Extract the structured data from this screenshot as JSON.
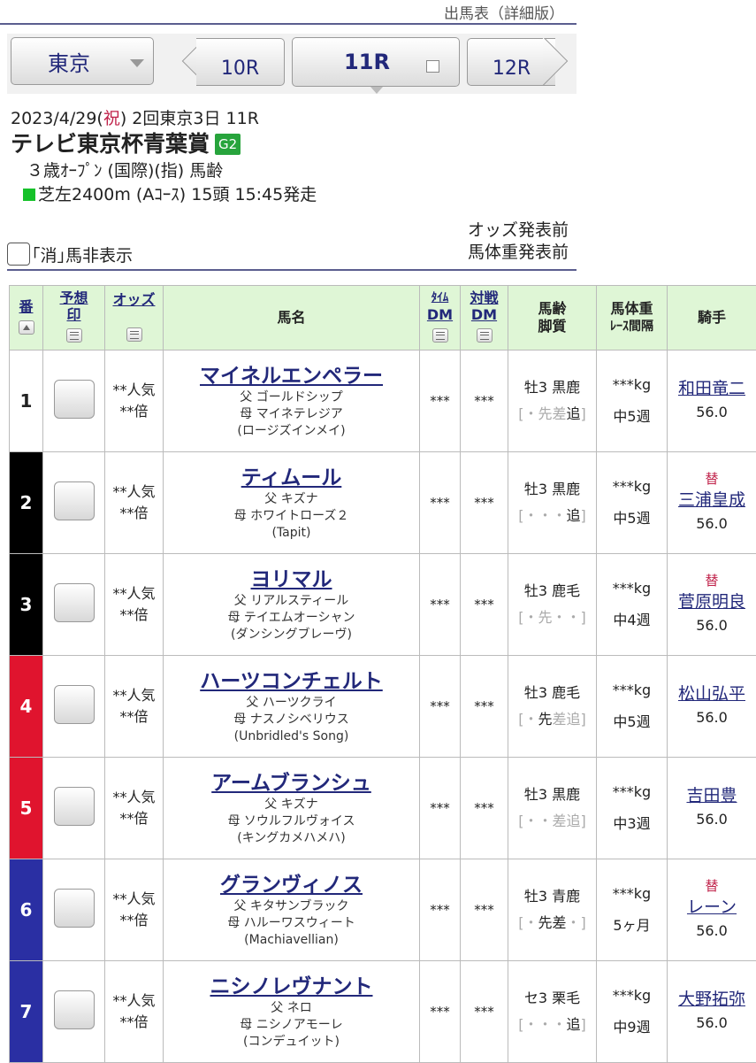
{
  "page_label": "出馬表（詳細版）",
  "nav": {
    "venue": "東京",
    "prev_race": "10R",
    "current_race": "11R",
    "next_race": "12R"
  },
  "race": {
    "date": "2023/4/29(",
    "holiday": "祝",
    "date_rest": ") 2回東京3日 11R",
    "name": "テレビ東京杯青葉賞",
    "grade": "G2",
    "conditions": "３歳ｵｰﾌﾟﾝ (国際)(指) 馬齢",
    "course": "芝左2400m (Aｺｰｽ) 15頭 15:45発走"
  },
  "hide_scratched_label": "｢消｣馬非表示",
  "status": {
    "odds": "オッズ発表前",
    "weight": "馬体重発表前"
  },
  "colors": {
    "frame_1": "#ffffff",
    "frame_2": "#000000",
    "frame_3": "#e0142e",
    "frame_4": "#2a2fa3",
    "header_bg": "#dff6d6",
    "link": "#22287a",
    "grade_badge": "#27a43c",
    "change_mark": "#c0224a"
  },
  "table": {
    "headers": {
      "num": "番",
      "mark": [
        "予想",
        "印"
      ],
      "odds": "オッズ",
      "name": "馬名",
      "time_dm": [
        "ﾀｲﾑ",
        "DM"
      ],
      "vs_dm": [
        "対戦",
        "DM"
      ],
      "age": [
        "馬齢",
        "脚質"
      ],
      "weight": [
        "馬体重",
        "ﾚｰｽ間隔"
      ],
      "jockey": "騎手"
    },
    "rows": [
      {
        "num": "1",
        "frame": 1,
        "odds1": "**人気",
        "odds2": "**倍",
        "name": "マイネルエンペラー",
        "sire": "父 ゴールドシップ",
        "dam": "母 マイネテレジア",
        "bms": "(ロージズインメイ)",
        "tdm": "***",
        "vdm": "***",
        "age": "牡3 黒鹿",
        "legs": [
          {
            "t": "[",
            "on": false
          },
          {
            "t": "・",
            "on": false
          },
          {
            "t": "先",
            "on": false
          },
          {
            "t": "差",
            "on": false
          },
          {
            "t": "追",
            "on": true
          },
          {
            "t": "]",
            "on": false
          }
        ],
        "weight": "***kg",
        "interval": "中5週",
        "change": "",
        "jockey": "和田竜二",
        "jwt": "56.0"
      },
      {
        "num": "2",
        "frame": 2,
        "odds1": "**人気",
        "odds2": "**倍",
        "name": "ティムール",
        "sire": "父 キズナ",
        "dam": "母 ホワイトローズ２",
        "bms": "(Tapit)",
        "tdm": "***",
        "vdm": "***",
        "age": "牡3 黒鹿",
        "legs": [
          {
            "t": "[",
            "on": false
          },
          {
            "t": "・",
            "on": false
          },
          {
            "t": "・",
            "on": false
          },
          {
            "t": "・",
            "on": false
          },
          {
            "t": "追",
            "on": true
          },
          {
            "t": "]",
            "on": false
          }
        ],
        "weight": "***kg",
        "interval": "中5週",
        "change": "替",
        "jockey": "三浦皇成",
        "jwt": "56.0"
      },
      {
        "num": "3",
        "frame": 2,
        "odds1": "**人気",
        "odds2": "**倍",
        "name": "ヨリマル",
        "sire": "父 リアルスティール",
        "dam": "母 テイエムオーシャン",
        "bms": "(ダンシングブレーヴ)",
        "tdm": "***",
        "vdm": "***",
        "age": "牡3 鹿毛",
        "legs": [
          {
            "t": "[",
            "on": false
          },
          {
            "t": "・",
            "on": false
          },
          {
            "t": "先",
            "on": false
          },
          {
            "t": "・",
            "on": false
          },
          {
            "t": "・",
            "on": false
          },
          {
            "t": "]",
            "on": false
          }
        ],
        "weight": "***kg",
        "interval": "中4週",
        "change": "替",
        "jockey": "菅原明良",
        "jwt": "56.0"
      },
      {
        "num": "4",
        "frame": 3,
        "odds1": "**人気",
        "odds2": "**倍",
        "name": "ハーツコンチェルト",
        "sire": "父 ハーツクライ",
        "dam": "母 ナスノシベリウス",
        "bms": "(Unbridled's Song)",
        "tdm": "***",
        "vdm": "***",
        "age": "牡3 鹿毛",
        "legs": [
          {
            "t": "[",
            "on": false
          },
          {
            "t": "・",
            "on": false
          },
          {
            "t": "先",
            "on": true
          },
          {
            "t": "差",
            "on": false
          },
          {
            "t": "追",
            "on": false
          },
          {
            "t": "]",
            "on": false
          }
        ],
        "weight": "***kg",
        "interval": "中5週",
        "change": "",
        "jockey": "松山弘平",
        "jwt": "56.0"
      },
      {
        "num": "5",
        "frame": 3,
        "odds1": "**人気",
        "odds2": "**倍",
        "name": "アームブランシュ",
        "sire": "父 キズナ",
        "dam": "母 ソウルフルヴォイス",
        "bms": "(キングカメハメハ)",
        "tdm": "***",
        "vdm": "***",
        "age": "牡3 黒鹿",
        "legs": [
          {
            "t": "[",
            "on": false
          },
          {
            "t": "・",
            "on": false
          },
          {
            "t": "・",
            "on": false
          },
          {
            "t": "差",
            "on": false
          },
          {
            "t": "追",
            "on": false
          },
          {
            "t": "]",
            "on": false
          }
        ],
        "weight": "***kg",
        "interval": "中3週",
        "change": "",
        "jockey": "吉田豊",
        "jwt": "56.0"
      },
      {
        "num": "6",
        "frame": 4,
        "odds1": "**人気",
        "odds2": "**倍",
        "name": "グランヴィノス",
        "sire": "父 キタサンブラック",
        "dam": "母 ハルーワスウィート",
        "bms": "(Machiavellian)",
        "tdm": "***",
        "vdm": "***",
        "age": "牡3 青鹿",
        "legs": [
          {
            "t": "[",
            "on": false
          },
          {
            "t": "・",
            "on": false
          },
          {
            "t": "先",
            "on": true
          },
          {
            "t": "差",
            "on": true
          },
          {
            "t": "・",
            "on": false
          },
          {
            "t": "]",
            "on": false
          }
        ],
        "weight": "***kg",
        "interval": "5ヶ月",
        "change": "替",
        "jockey": "レーン",
        "jwt": "56.0"
      },
      {
        "num": "7",
        "frame": 4,
        "odds1": "**人気",
        "odds2": "**倍",
        "name": "ニシノレヴナント",
        "sire": "父 ネロ",
        "dam": "母 ニシノアモーレ",
        "bms": "(コンデュイット)",
        "tdm": "***",
        "vdm": "***",
        "age": "セ3 栗毛",
        "legs": [
          {
            "t": "[",
            "on": false
          },
          {
            "t": "・",
            "on": false
          },
          {
            "t": "・",
            "on": false
          },
          {
            "t": "・",
            "on": false
          },
          {
            "t": "追",
            "on": true
          },
          {
            "t": "]",
            "on": false
          }
        ],
        "weight": "***kg",
        "interval": "中9週",
        "change": "",
        "jockey": "大野拓弥",
        "jwt": "56.0"
      }
    ]
  }
}
